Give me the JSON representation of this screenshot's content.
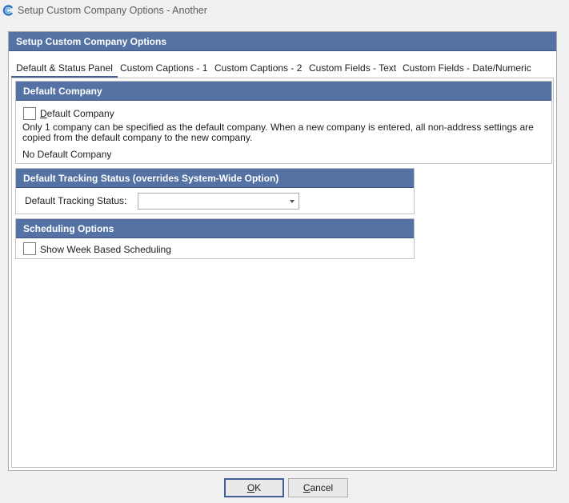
{
  "window": {
    "title": "Setup Custom Company Options - Another"
  },
  "panel": {
    "title": "Setup Custom Company Options"
  },
  "tabs": [
    {
      "label": "Default & Status Panel",
      "active": true
    },
    {
      "label": "Custom Captions - 1"
    },
    {
      "label": "Custom Captions - 2"
    },
    {
      "label": "Custom Fields - Text"
    },
    {
      "label": "Custom Fields - Date/Numeric"
    }
  ],
  "default_company": {
    "header": "Default Company",
    "checkbox_label_first": "D",
    "checkbox_label_rest": "efault Company",
    "checked": false,
    "description_line1": "Only 1 company can be specified as the default company.  When a new company is entered, all non-address settings are",
    "description_line2": "copied from the default company to the new company.",
    "status": "No Default Company"
  },
  "tracking": {
    "header": "Default Tracking Status (overrides System-Wide Option)",
    "label": "Default Tracking Status:",
    "value": ""
  },
  "scheduling": {
    "header": "Scheduling Options",
    "checkbox_label": "Show Week Based Scheduling",
    "checked": false
  },
  "buttons": {
    "ok_first": "O",
    "ok_rest": "K",
    "cancel_first": "C",
    "cancel_rest": "ancel"
  },
  "colors": {
    "header_bg": "#5572a4",
    "active_tab_underline": "#3f5f96",
    "app_icon": "#2e6fbf"
  },
  "icons": {
    "app": "app-logo-icon",
    "dropdown": "chevron-down-icon"
  }
}
